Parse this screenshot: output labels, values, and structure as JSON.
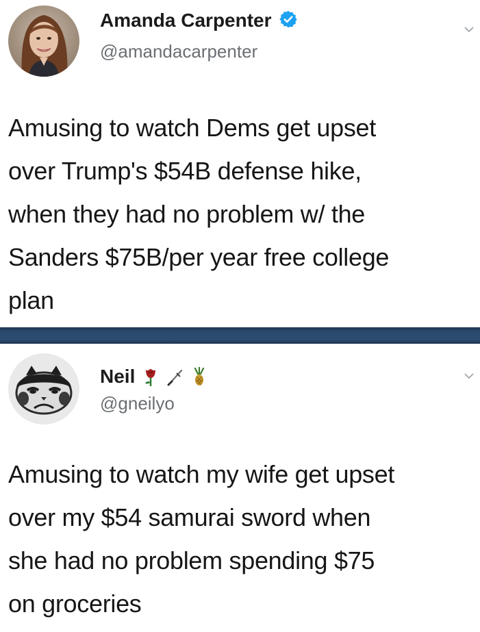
{
  "tweets": [
    {
      "display_name": "Amanda Carpenter",
      "handle": "@amandacarpenter",
      "verified": true,
      "verified_color": "#1da1f2",
      "avatar_icon": "profile-photo-woman",
      "text_lines": [
        "Amusing to watch Dems get upset",
        "over Trump's $54B defense hike,",
        "when they had no problem w/ the",
        "Sanders $75B/per year free college",
        "plan"
      ]
    },
    {
      "display_name": "Neil",
      "handle": "@gneilyo",
      "name_emojis": [
        "rose-icon",
        "sword-icon",
        "pineapple-icon"
      ],
      "avatar_icon": "grumpy-cat-icon",
      "text_lines": [
        "Amusing to watch my wife get upset",
        "over my $54 samurai sword when",
        "she had no problem spending $75",
        "on groceries"
      ]
    }
  ],
  "divider_color": "#2c4d70"
}
